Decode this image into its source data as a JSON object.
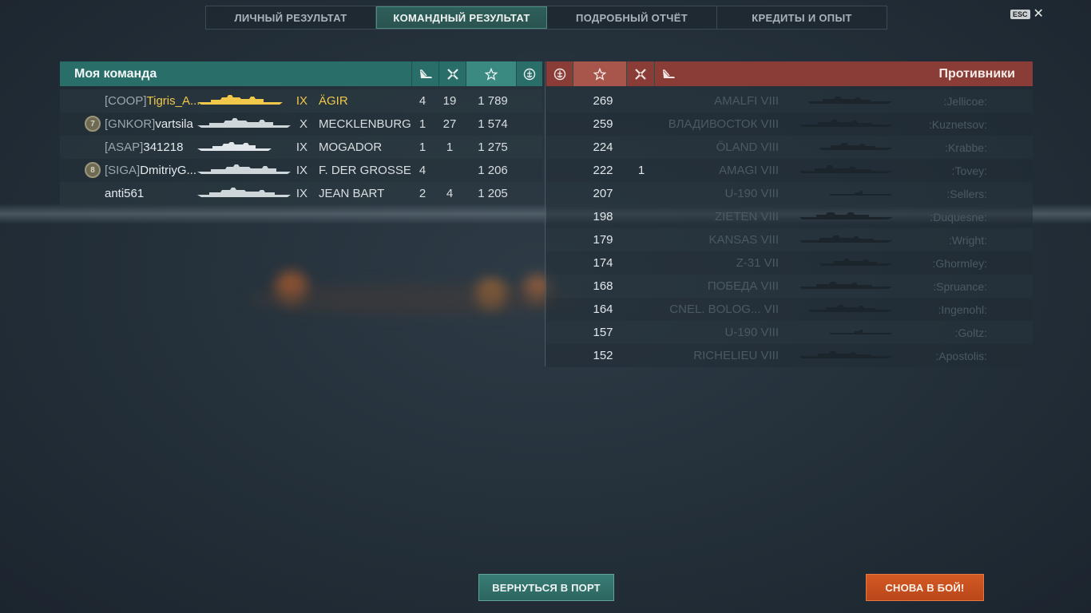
{
  "tabs": [
    {
      "label": "ЛИЧНЫЙ РЕЗУЛЬТАТ"
    },
    {
      "label": "КОМАНДНЫЙ РЕЗУЛЬТАТ"
    },
    {
      "label": "ПОДРОБНЫЙ ОТЧЁТ"
    },
    {
      "label": "КРЕДИТЫ И ОПЫТ"
    }
  ],
  "esc": {
    "key": "ESC",
    "icon": "close-icon"
  },
  "my_team": {
    "title": "Моя команда",
    "header_icons": [
      "ship-sunk-icon",
      "frags-icon",
      "star-icon",
      "emblem-icon"
    ],
    "rows": [
      {
        "badge": "",
        "clan": "[COOP]",
        "name": "Tigris_A...",
        "tier": "IX",
        "ship": "ÄGIR",
        "col1": "4",
        "col2": "19",
        "score": "1 789",
        "me": true
      },
      {
        "badge": "7",
        "clan": "[GNKOR]",
        "name": "vartsila",
        "tier": "X",
        "ship": "MECKLENBURG",
        "col1": "1",
        "col2": "27",
        "score": "1 574",
        "me": false
      },
      {
        "badge": "",
        "clan": "[ASAP]",
        "name": "341218",
        "tier": "IX",
        "ship": "MOGADOR",
        "col1": "1",
        "col2": "1",
        "score": "1 275",
        "me": false
      },
      {
        "badge": "8",
        "clan": "[SIGA]",
        "name": "DmitriyG...",
        "tier": "IX",
        "ship": "F. DER GROSSE",
        "col1": "4",
        "col2": "",
        "score": "1 206",
        "me": false
      },
      {
        "badge": "",
        "clan": "",
        "name": "anti561",
        "tier": "IX",
        "ship": "JEAN BART",
        "col1": "2",
        "col2": "4",
        "score": "1 205",
        "me": false
      }
    ]
  },
  "enemy_team": {
    "title": "Противники",
    "header_icons": [
      "emblem-icon",
      "star-icon",
      "frags-icon",
      "ship-sunk-icon"
    ],
    "rows": [
      {
        "score": "269",
        "kills": "",
        "ship": "AMALFI VIII",
        "player": ":Jellicoe:"
      },
      {
        "score": "259",
        "kills": "",
        "ship": "ВЛАДИВОСТОК VIII",
        "player": ":Kuznetsov:"
      },
      {
        "score": "224",
        "kills": "",
        "ship": "ÖLAND VIII",
        "player": ":Krabbe:"
      },
      {
        "score": "222",
        "kills": "1",
        "ship": "AMAGI VIII",
        "player": ":Tovey:"
      },
      {
        "score": "207",
        "kills": "",
        "ship": "U-190 VIII",
        "player": ":Sellers:"
      },
      {
        "score": "198",
        "kills": "",
        "ship": "ZIETEN VIII",
        "player": ":Duquesne:"
      },
      {
        "score": "179",
        "kills": "",
        "ship": "KANSAS VIII",
        "player": ":Wright:"
      },
      {
        "score": "174",
        "kills": "",
        "ship": "Z-31 VII",
        "player": ":Ghormley:"
      },
      {
        "score": "168",
        "kills": "",
        "ship": "ПОБЕДА VIII",
        "player": ":Spruance:"
      },
      {
        "score": "164",
        "kills": "",
        "ship": "CNEL. BOLOG... VII",
        "player": ":Ingenohl:"
      },
      {
        "score": "157",
        "kills": "",
        "ship": "U-190 VIII",
        "player": ":Goltz:"
      },
      {
        "score": "152",
        "kills": "",
        "ship": "RICHELIEU VIII",
        "player": ":Apostolis:"
      }
    ]
  },
  "buttons": {
    "port": "ВЕРНУТЬСЯ В ПОРТ",
    "battle": "СНОВА В БОЙ!"
  },
  "colors": {
    "my_team": "#2a6e69",
    "enemy_team": "#8a3d36",
    "highlight": "#f2c84b",
    "battle_button": "#c9501f"
  }
}
